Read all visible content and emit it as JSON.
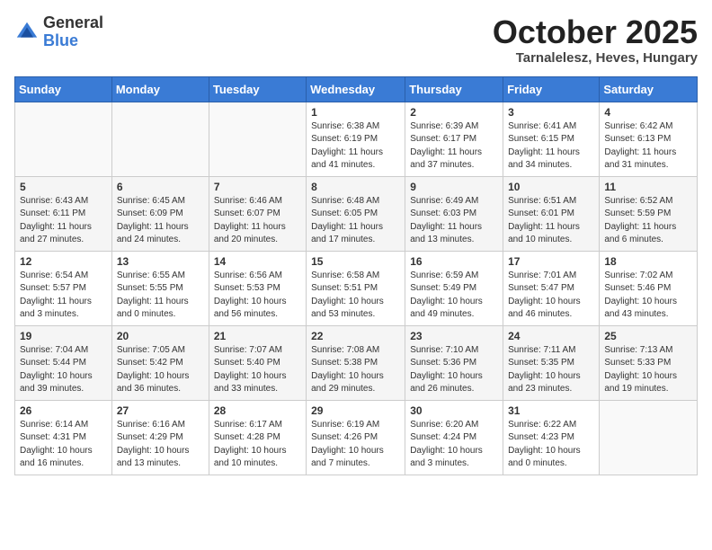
{
  "header": {
    "logo_line1": "General",
    "logo_line2": "Blue",
    "month_title": "October 2025",
    "location": "Tarnalelesz, Heves, Hungary"
  },
  "weekdays": [
    "Sunday",
    "Monday",
    "Tuesday",
    "Wednesday",
    "Thursday",
    "Friday",
    "Saturday"
  ],
  "weeks": [
    [
      {
        "day": "",
        "content": ""
      },
      {
        "day": "",
        "content": ""
      },
      {
        "day": "",
        "content": ""
      },
      {
        "day": "1",
        "content": "Sunrise: 6:38 AM\nSunset: 6:19 PM\nDaylight: 11 hours\nand 41 minutes."
      },
      {
        "day": "2",
        "content": "Sunrise: 6:39 AM\nSunset: 6:17 PM\nDaylight: 11 hours\nand 37 minutes."
      },
      {
        "day": "3",
        "content": "Sunrise: 6:41 AM\nSunset: 6:15 PM\nDaylight: 11 hours\nand 34 minutes."
      },
      {
        "day": "4",
        "content": "Sunrise: 6:42 AM\nSunset: 6:13 PM\nDaylight: 11 hours\nand 31 minutes."
      }
    ],
    [
      {
        "day": "5",
        "content": "Sunrise: 6:43 AM\nSunset: 6:11 PM\nDaylight: 11 hours\nand 27 minutes."
      },
      {
        "day": "6",
        "content": "Sunrise: 6:45 AM\nSunset: 6:09 PM\nDaylight: 11 hours\nand 24 minutes."
      },
      {
        "day": "7",
        "content": "Sunrise: 6:46 AM\nSunset: 6:07 PM\nDaylight: 11 hours\nand 20 minutes."
      },
      {
        "day": "8",
        "content": "Sunrise: 6:48 AM\nSunset: 6:05 PM\nDaylight: 11 hours\nand 17 minutes."
      },
      {
        "day": "9",
        "content": "Sunrise: 6:49 AM\nSunset: 6:03 PM\nDaylight: 11 hours\nand 13 minutes."
      },
      {
        "day": "10",
        "content": "Sunrise: 6:51 AM\nSunset: 6:01 PM\nDaylight: 11 hours\nand 10 minutes."
      },
      {
        "day": "11",
        "content": "Sunrise: 6:52 AM\nSunset: 5:59 PM\nDaylight: 11 hours\nand 6 minutes."
      }
    ],
    [
      {
        "day": "12",
        "content": "Sunrise: 6:54 AM\nSunset: 5:57 PM\nDaylight: 11 hours\nand 3 minutes."
      },
      {
        "day": "13",
        "content": "Sunrise: 6:55 AM\nSunset: 5:55 PM\nDaylight: 11 hours\nand 0 minutes."
      },
      {
        "day": "14",
        "content": "Sunrise: 6:56 AM\nSunset: 5:53 PM\nDaylight: 10 hours\nand 56 minutes."
      },
      {
        "day": "15",
        "content": "Sunrise: 6:58 AM\nSunset: 5:51 PM\nDaylight: 10 hours\nand 53 minutes."
      },
      {
        "day": "16",
        "content": "Sunrise: 6:59 AM\nSunset: 5:49 PM\nDaylight: 10 hours\nand 49 minutes."
      },
      {
        "day": "17",
        "content": "Sunrise: 7:01 AM\nSunset: 5:47 PM\nDaylight: 10 hours\nand 46 minutes."
      },
      {
        "day": "18",
        "content": "Sunrise: 7:02 AM\nSunset: 5:46 PM\nDaylight: 10 hours\nand 43 minutes."
      }
    ],
    [
      {
        "day": "19",
        "content": "Sunrise: 7:04 AM\nSunset: 5:44 PM\nDaylight: 10 hours\nand 39 minutes."
      },
      {
        "day": "20",
        "content": "Sunrise: 7:05 AM\nSunset: 5:42 PM\nDaylight: 10 hours\nand 36 minutes."
      },
      {
        "day": "21",
        "content": "Sunrise: 7:07 AM\nSunset: 5:40 PM\nDaylight: 10 hours\nand 33 minutes."
      },
      {
        "day": "22",
        "content": "Sunrise: 7:08 AM\nSunset: 5:38 PM\nDaylight: 10 hours\nand 29 minutes."
      },
      {
        "day": "23",
        "content": "Sunrise: 7:10 AM\nSunset: 5:36 PM\nDaylight: 10 hours\nand 26 minutes."
      },
      {
        "day": "24",
        "content": "Sunrise: 7:11 AM\nSunset: 5:35 PM\nDaylight: 10 hours\nand 23 minutes."
      },
      {
        "day": "25",
        "content": "Sunrise: 7:13 AM\nSunset: 5:33 PM\nDaylight: 10 hours\nand 19 minutes."
      }
    ],
    [
      {
        "day": "26",
        "content": "Sunrise: 6:14 AM\nSunset: 4:31 PM\nDaylight: 10 hours\nand 16 minutes."
      },
      {
        "day": "27",
        "content": "Sunrise: 6:16 AM\nSunset: 4:29 PM\nDaylight: 10 hours\nand 13 minutes."
      },
      {
        "day": "28",
        "content": "Sunrise: 6:17 AM\nSunset: 4:28 PM\nDaylight: 10 hours\nand 10 minutes."
      },
      {
        "day": "29",
        "content": "Sunrise: 6:19 AM\nSunset: 4:26 PM\nDaylight: 10 hours\nand 7 minutes."
      },
      {
        "day": "30",
        "content": "Sunrise: 6:20 AM\nSunset: 4:24 PM\nDaylight: 10 hours\nand 3 minutes."
      },
      {
        "day": "31",
        "content": "Sunrise: 6:22 AM\nSunset: 4:23 PM\nDaylight: 10 hours\nand 0 minutes."
      },
      {
        "day": "",
        "content": ""
      }
    ]
  ]
}
